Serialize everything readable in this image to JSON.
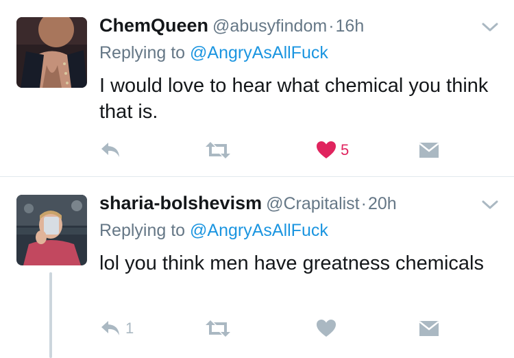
{
  "tweets": [
    {
      "name": "ChemQueen",
      "handle": "@abusyfindom",
      "dot": "·",
      "time": "16h",
      "replying_prefix": "Replying to",
      "replying_to": "@AngryAsAllFuck",
      "text": "I would love to hear what chemical you think that is.",
      "reply_count": "",
      "retweet_count": "",
      "like_count": "5",
      "liked": true
    },
    {
      "name": "sharia-bolshevism",
      "handle": "@Crapitalist",
      "dot": "·",
      "time": "20h",
      "replying_prefix": "Replying to",
      "replying_to": "@AngryAsAllFuck",
      "text": "lol you think men have greatness chemicals",
      "reply_count": "1",
      "retweet_count": "",
      "like_count": "",
      "liked": false
    }
  ],
  "colors": {
    "name": "#14171a",
    "meta": "#657786",
    "mention": "#1b95e0",
    "like_active": "#e0245e",
    "icon": "#aab8c2",
    "divider": "#e1e8ed"
  },
  "icons": [
    "chevron-down-icon",
    "reply-icon",
    "retweet-icon",
    "heart-icon",
    "direct-message-icon"
  ]
}
